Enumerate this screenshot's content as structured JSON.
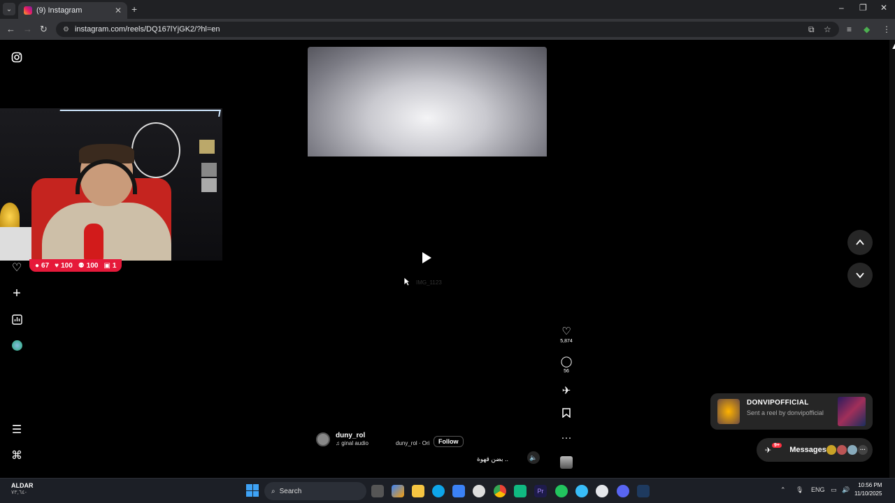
{
  "browser": {
    "tab_title": "(9) Instagram",
    "tab_close": "✕",
    "new_tab": "+",
    "url": "instagram.com/reels/DQ167lYjGK2/?hl=en",
    "window": {
      "minimize": "–",
      "restore": "❐",
      "close": "✕"
    }
  },
  "stream_overlay": {
    "comments": "67",
    "likes": "100",
    "followers": "100",
    "subs": "1"
  },
  "reel": {
    "watermark": "IMG_1123",
    "username": "duny_rol",
    "audio_label": "♫ ginal audio",
    "audio_label2": "duny_rol · Ori",
    "follow_label": "Follow",
    "caption": "بضن قهوة ..",
    "likes_count": "5,874",
    "comments_count": "56"
  },
  "notification": {
    "sender": "DONVIPOFFICIAL",
    "message": "Sent a reel by donvipofficial"
  },
  "messages": {
    "label": "Messages",
    "badge": "9+"
  },
  "taskbar": {
    "weather_title": "ALDAR",
    "weather_sub": "٧٣,٦٤-",
    "search_label": "Search",
    "lang": "ENG",
    "time": "10:56 PM",
    "date": "11/10/2025"
  },
  "colors": {
    "stream_badge": "#e6193a",
    "accent_blue": "#3ea2f5"
  }
}
